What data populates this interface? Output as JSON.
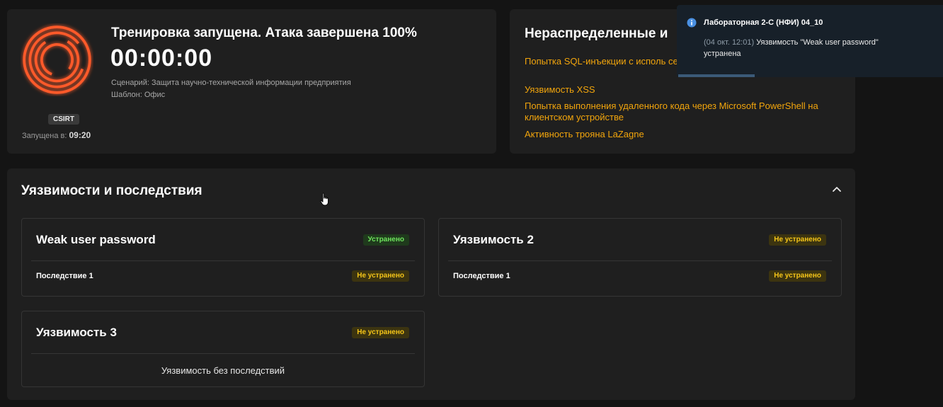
{
  "training": {
    "title": "Тренировка запущена. Атака завершена 100%",
    "timer": "00:00:00",
    "scenario": "Сценарий: Защита научно-технической информации предприятия",
    "template": "Шаблон: Офис",
    "role": "CSIRT",
    "started_label": "Запущена в:",
    "started_time": "09:20"
  },
  "incidents": {
    "title": "Нераспределенные и",
    "items": [
      "Попытка SQL-инъекции с исполь сервере redmine.ampire.corp",
      "Уязвимость XSS",
      "Попытка выполнения удаленного кода через Microsoft PowerShell на клиентском устройстве",
      "Активность трояна LaZagne"
    ]
  },
  "vulnerabilities": {
    "title": "Уязвимости и последствия",
    "cards": [
      {
        "name": "Weak user password",
        "status": "Устранено",
        "consequence": "Последствие 1",
        "consequence_status": "Не устранено"
      },
      {
        "name": "Уязвимость 2",
        "status": "Не устранено",
        "consequence": "Последствие 1",
        "consequence_status": "Не устранено"
      },
      {
        "name": "Уязвимость 3",
        "status": "Не устранено",
        "empty_text": "Уязвимость без последствий"
      }
    ]
  },
  "toast": {
    "title": "Лабораторная 2-С (НФИ) 04_10",
    "time": "(04 окт. 12:01)",
    "message": "Уязвимость \"Weak user password\" устранена"
  },
  "colors": {
    "accent_orange": "#f2a50c",
    "status_fixed": "#6ee45d",
    "status_not_fixed": "#f5c518",
    "ring": "#ff5a2a"
  },
  "icons": [
    "training-rings-icon",
    "chevron-up-icon",
    "info-icon",
    "hand-cursor-icon"
  ]
}
